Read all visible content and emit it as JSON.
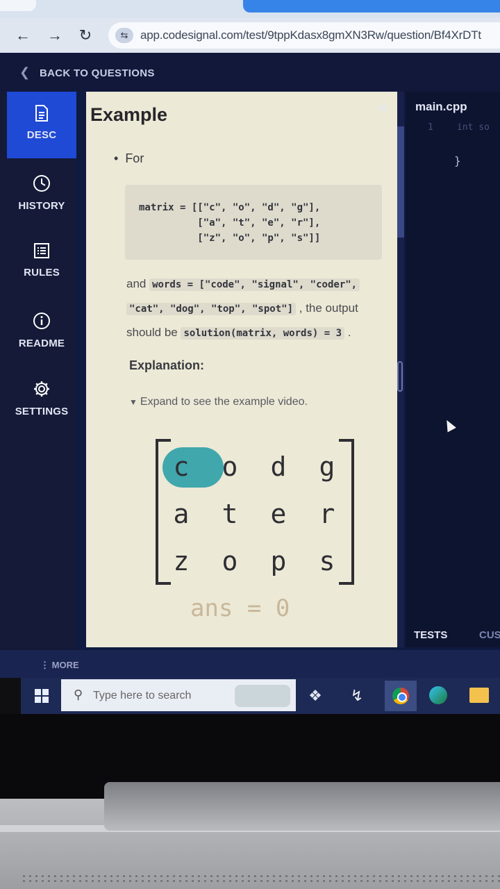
{
  "browser": {
    "url": "app.codesignal.com/test/9tppKdasx8gmXN3Rw/question/Bf4XrDTt"
  },
  "app": {
    "back_label": "BACK TO QUESTIONS",
    "sidebar": [
      {
        "label": "DESC",
        "icon": "document-icon",
        "active": true
      },
      {
        "label": "HISTORY",
        "icon": "clock-icon",
        "active": false
      },
      {
        "label": "RULES",
        "icon": "list-icon",
        "active": false
      },
      {
        "label": "README",
        "icon": "info-icon",
        "active": false
      },
      {
        "label": "SETTINGS",
        "icon": "gear-icon",
        "active": false
      }
    ],
    "more_label": "MORE"
  },
  "description": {
    "title": "Example",
    "bullet": "For",
    "matrix_code": "matrix = [[\"c\", \"o\", \"d\", \"g\"],\n          [\"a\", \"t\", \"e\", \"r\"],\n          [\"z\", \"o\", \"p\", \"s\"]]",
    "and_text": "and",
    "words_code": "words = [\"code\", \"signal\", \"coder\",",
    "words_code2": "\"cat\", \"dog\", \"top\", \"spot\"]",
    "output_text": ", the output",
    "should_be_text": "should be",
    "solution_code": "solution(matrix, words) = 3",
    "period": ".",
    "explanation_label": "Explanation:",
    "expand_text": "Expand to see the example video.",
    "grid": [
      [
        "c",
        "o",
        "d",
        "g"
      ],
      [
        "a",
        "t",
        "e",
        "r"
      ],
      [
        "z",
        "o",
        "p",
        "s"
      ]
    ],
    "highlight_color": "#2da0a8",
    "ans_text": "ans = 0"
  },
  "editor": {
    "filename": "main.cpp",
    "line_number": "1",
    "line1": "int so",
    "line2": "}",
    "tests_tab": "TESTS",
    "custom_tab": "CUS"
  },
  "taskbar": {
    "search_placeholder": "Type here to search"
  }
}
